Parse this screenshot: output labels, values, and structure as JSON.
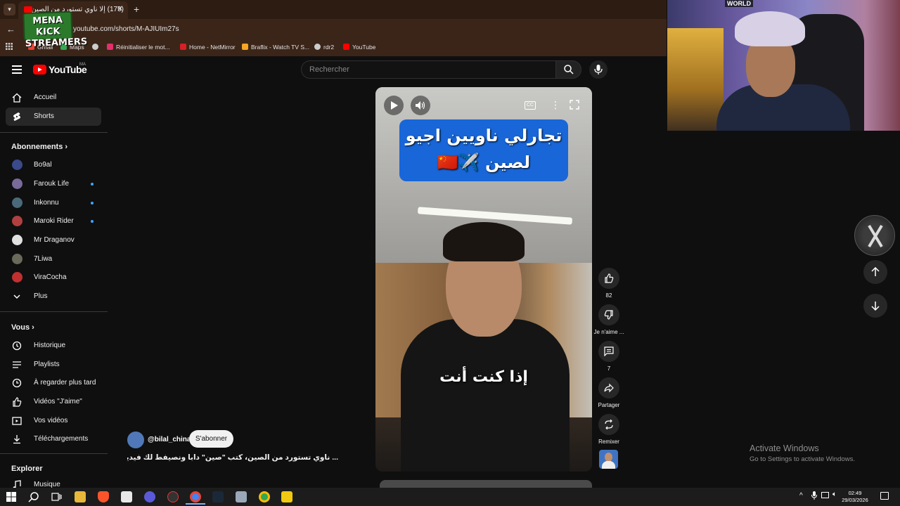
{
  "browser": {
    "tab_title": "(179) إلا ناوي تستورد من الصين...",
    "url": "youtube.com/shorts/M-AJIUIm27s",
    "overlay_logo": "MENA KICK STREAMERS",
    "bookmarks": [
      {
        "label": "Gmail",
        "icon": "gmail-icon",
        "color": "#ea4335"
      },
      {
        "label": "Maps",
        "icon": "maps-icon",
        "color": "#34a853"
      },
      {
        "label": "",
        "icon": "link-icon",
        "color": "#cccccc"
      },
      {
        "label": "Réinitialiser le mot...",
        "icon": "instagram-icon",
        "color": "#e1306c"
      },
      {
        "label": "Home - NetMirror",
        "icon": "netmirror-icon",
        "color": "#d81f26"
      },
      {
        "label": "Braflix - Watch TV S...",
        "icon": "braflix-icon",
        "color": "#f5a623"
      },
      {
        "label": "rdr2",
        "icon": "globe-icon",
        "color": "#cccccc"
      },
      {
        "label": "YouTube",
        "icon": "youtube-icon",
        "color": "#ff0000"
      }
    ]
  },
  "youtube": {
    "brand": "YouTube",
    "country": "MA",
    "search_placeholder": "Rechercher",
    "nav": [
      {
        "label": "Accueil",
        "icon": "home-icon"
      },
      {
        "label": "Shorts",
        "icon": "shorts-icon",
        "active": true
      }
    ],
    "subscriptions_title": "Abonnements",
    "subscriptions": [
      {
        "label": "Bo9al",
        "dot": false,
        "color": "#3a4a8a"
      },
      {
        "label": "Farouk Life",
        "dot": true,
        "color": "#7a6a9a"
      },
      {
        "label": "Inkonnu",
        "dot": true,
        "color": "#4a6a7a"
      },
      {
        "label": "Maroki Rider",
        "dot": true,
        "color": "#b04040"
      },
      {
        "label": "Mr Draganov",
        "dot": false,
        "color": "#e0e0e0"
      },
      {
        "label": "7Liwa",
        "dot": false,
        "color": "#6a6a5a"
      },
      {
        "label": "ViraCocha",
        "dot": false,
        "color": "#c03030"
      }
    ],
    "more_label": "Plus",
    "you_title": "Vous",
    "you_items": [
      {
        "label": "Historique",
        "icon": "history-icon"
      },
      {
        "label": "Playlists",
        "icon": "playlists-icon"
      },
      {
        "label": "À regarder plus tard",
        "icon": "watch-later-icon"
      },
      {
        "label": "Vidéos \"J'aime\"",
        "icon": "like-icon"
      },
      {
        "label": "Vos vidéos",
        "icon": "your-videos-icon"
      },
      {
        "label": "Téléchargements",
        "icon": "download-icon"
      }
    ],
    "explore_title": "Explorer",
    "explore_items": [
      {
        "label": "Musique",
        "icon": "music-icon"
      }
    ]
  },
  "short": {
    "title_overlay": "تجارلي ناويين اجيو لصين",
    "title_flags": "✈️🇨🇳",
    "caption": "إذا كنت أنت",
    "channel": "@bilal_china",
    "subscribe_label": "S'abonner",
    "description": "... ناوي تستورد من الصين، كتب \"صين\" دابا ونصيفط لك فيديو مجاني",
    "likes": "82",
    "dislike_label": "Je n'aime ...",
    "comments": "7",
    "share_label": "Partager",
    "remix_label": "Remixer"
  },
  "webcam": {
    "banner": "WORLD"
  },
  "watermark": {
    "line1": "Activate Windows",
    "line2": "Go to Settings to activate Windows."
  },
  "taskbar": {
    "time": "02:49",
    "date": "29/03/2026"
  }
}
